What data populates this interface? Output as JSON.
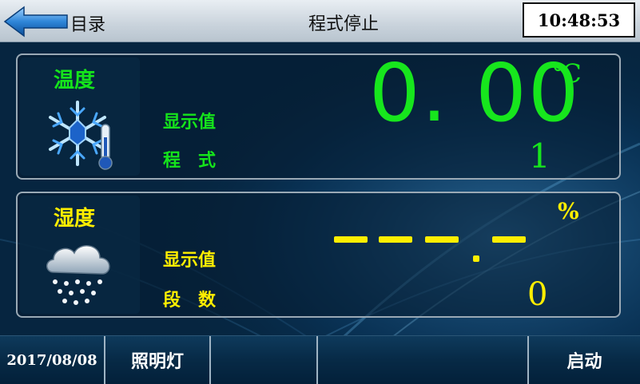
{
  "header": {
    "back_label": "目录",
    "title": "程式停止",
    "clock": "10:48:53"
  },
  "temperature": {
    "title": "温度",
    "display_label": "显示值",
    "program_label": "程　式",
    "display_value": "0. 00",
    "unit": "℃",
    "program_value": "1",
    "color": "#17e61d",
    "icon": "snowflake-thermometer-icon"
  },
  "humidity": {
    "title": "湿度",
    "display_label": "显示值",
    "segment_label": "段　数",
    "unit": "%",
    "segment_value": "0",
    "color": "#ffee00",
    "icon": "snow-cloud-icon"
  },
  "footer": {
    "date": "2017/08/08",
    "light_label": "照明灯",
    "start_label": "启动"
  }
}
